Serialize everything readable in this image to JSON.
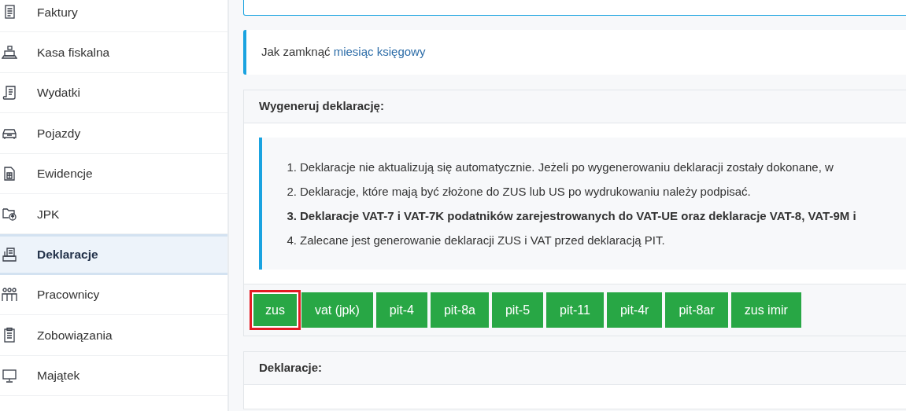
{
  "sidebar": {
    "items": [
      {
        "label": "Faktury",
        "selected": false
      },
      {
        "label": "Kasa fiskalna",
        "selected": false
      },
      {
        "label": "Wydatki",
        "selected": false
      },
      {
        "label": "Pojazdy",
        "selected": false
      },
      {
        "label": "Ewidencje",
        "selected": false
      },
      {
        "label": "JPK",
        "selected": false
      },
      {
        "label": "Deklaracje",
        "selected": true
      },
      {
        "label": "Pracownicy",
        "selected": false
      },
      {
        "label": "Zobowiązania",
        "selected": false
      },
      {
        "label": "Majątek",
        "selected": false
      }
    ]
  },
  "info": {
    "text": "Jak zamknąć",
    "link": "miesiąc księgowy"
  },
  "generate_panel": {
    "title": "Wygeneruj deklarację:",
    "notes": [
      {
        "number": "1.",
        "text": "Deklaracje nie aktualizują się automatycznie. Jeżeli po wygenerowaniu deklaracji zostały dokonane, w",
        "bold": false
      },
      {
        "number": "2.",
        "text": "Deklaracje, które mają być złożone do ZUS lub US po wydrukowaniu należy podpisać.",
        "bold": false
      },
      {
        "number": "3.",
        "text": "Deklaracje VAT-7 i VAT-7K podatników zarejestrowanych do VAT-UE oraz deklaracje VAT-8, VAT-9M i",
        "bold": true
      },
      {
        "number": "4.",
        "text": "Zalecane jest generowanie deklaracji ZUS i VAT przed deklaracją PIT.",
        "bold": false
      }
    ],
    "buttons": [
      {
        "label": "zus",
        "highlighted": true
      },
      {
        "label": "vat (jpk)",
        "highlighted": false
      },
      {
        "label": "pit-4",
        "highlighted": false
      },
      {
        "label": "pit-8a",
        "highlighted": false
      },
      {
        "label": "pit-5",
        "highlighted": false
      },
      {
        "label": "pit-11",
        "highlighted": false
      },
      {
        "label": "pit-4r",
        "highlighted": false
      },
      {
        "label": "pit-8ar",
        "highlighted": false
      },
      {
        "label": "zus imir",
        "highlighted": false
      }
    ]
  },
  "declarations_panel": {
    "title": "Deklaracje:"
  }
}
